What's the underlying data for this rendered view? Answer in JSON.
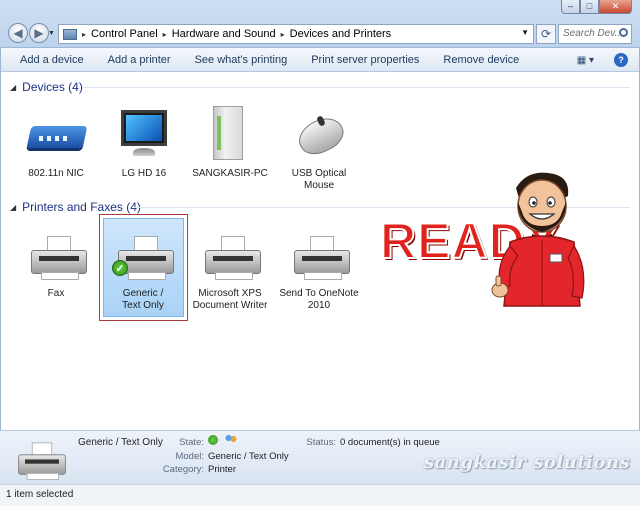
{
  "address": {
    "crumbs": [
      "Control Panel",
      "Hardware and Sound",
      "Devices and Printers"
    ],
    "search_placeholder": "Search Dev..."
  },
  "toolbar": {
    "add_device": "Add a device",
    "add_printer": "Add a printer",
    "see_printing": "See what's printing",
    "print_server": "Print server properties",
    "remove_device": "Remove device"
  },
  "devices": {
    "header": "Devices (4)",
    "items": [
      "802.11n NIC",
      "LG HD 16",
      "SANGKASIR-PC",
      "USB Optical Mouse"
    ]
  },
  "printers": {
    "header": "Printers and Faxes (4)",
    "items": [
      "Fax",
      "Generic / Text Only",
      "Microsoft XPS Document Writer",
      "Send To OneNote 2010"
    ]
  },
  "overlay": {
    "ready_text": "READY",
    "watermark": "sangkasir solutions"
  },
  "details": {
    "name": "Generic / Text Only",
    "state_label": "State:",
    "model_label": "Model:",
    "model_value": "Generic / Text Only",
    "category_label": "Category:",
    "category_value": "Printer",
    "status_label": "Status:",
    "status_value": "0 document(s) in queue"
  },
  "statusbar": {
    "text": "1 item selected"
  },
  "colors": {
    "accent": "#1e3287",
    "ready": "#e0231c",
    "selection_border": "#b03a3a"
  }
}
